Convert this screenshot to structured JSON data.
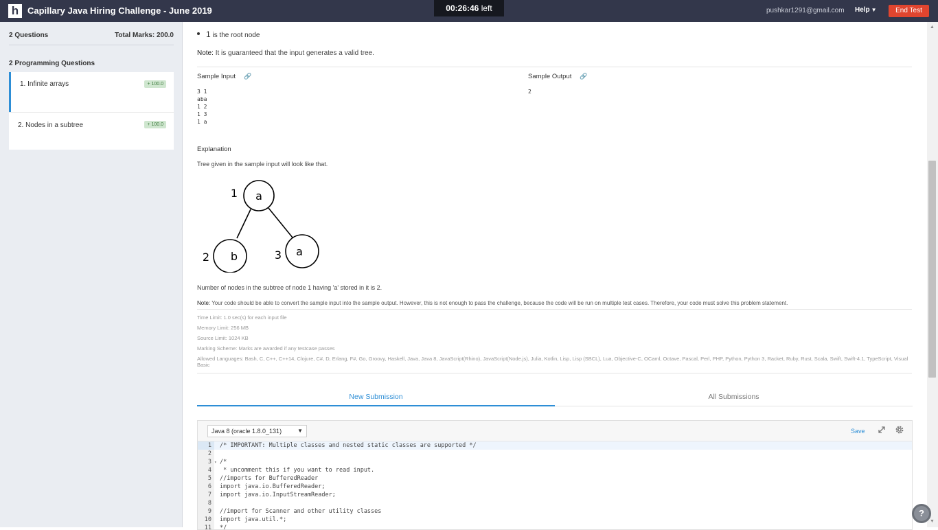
{
  "header": {
    "logo_letter": "h",
    "title": "Capillary Java Hiring Challenge - June 2019",
    "timer_value": "00:26:46",
    "timer_suffix": "left",
    "user_email": "pushkar1291@gmail.com",
    "help_label": "Help",
    "end_test_label": "End Test"
  },
  "sidebar": {
    "questions_count": "2 Questions",
    "total_marks": "Total Marks: 200.0",
    "section_title": "2 Programming Questions",
    "questions": [
      {
        "label": "1. Infinite arrays",
        "marks": "+ 100.0"
      },
      {
        "label": "2. Nodes in a subtree",
        "marks": "+ 100.0"
      }
    ]
  },
  "problem": {
    "bullet_num": "1",
    "bullet_text": "is the root node",
    "note_label": "Note:",
    "note_text": "It is guaranteed that the input generates a valid tree.",
    "sample_input_title": "Sample Input",
    "sample_output_title": "Sample Output",
    "sample_input": "3 1\naba\n1 2\n1 3\n1 a",
    "sample_output": "2",
    "explanation_title": "Explanation",
    "explanation_text": "Tree given in the sample input will look like that.",
    "tree": {
      "nodes": [
        {
          "id": "1",
          "value": "a"
        },
        {
          "id": "2",
          "value": "b"
        },
        {
          "id": "3",
          "value": "a"
        }
      ]
    },
    "count_text": "Number of nodes in the subtree of node 1 having 'a' stored in it is 2.",
    "note2_label": "Note:",
    "note2_text": "Your code should be able to convert the sample input into the sample output. However, this is not enough to pass the challenge, because the code will be run on multiple test cases. Therefore, your code must solve this problem statement.",
    "limits": {
      "time": "Time Limit: 1.0 sec(s) for each input file",
      "memory": "Memory Limit: 256 MB",
      "source": "Source Limit: 1024 KB",
      "marking": "Marking Scheme: Marks are awarded if any testcase passes",
      "languages": "Allowed Languages: Bash, C, C++, C++14, Clojure, C#, D, Erlang, F#, Go, Groovy, Haskell, Java, Java 8, JavaScript(Rhino), JavaScript(Node.js), Julia, Kotlin, Lisp, Lisp (SBCL), Lua, Objective-C, OCaml, Octave, Pascal, Perl, PHP, Python, Python 3, Racket, Ruby, Rust, Scala, Swift, Swift-4.1, TypeScript, Visual Basic"
    }
  },
  "tabs": {
    "new_submission": "New Submission",
    "all_submissions": "All Submissions"
  },
  "editor": {
    "language": "Java 8 (oracle 1.8.0_131)",
    "save_label": "Save",
    "lines": [
      {
        "n": "1",
        "text": "/* IMPORTANT: Multiple classes and nested static classes are supported */"
      },
      {
        "n": "2",
        "text": ""
      },
      {
        "n": "3",
        "text": "/*"
      },
      {
        "n": "4",
        "text": " * uncomment this if you want to read input."
      },
      {
        "n": "5",
        "text": "//imports for BufferedReader"
      },
      {
        "n": "6",
        "text": "import java.io.BufferedReader;"
      },
      {
        "n": "7",
        "text": "import java.io.InputStreamReader;"
      },
      {
        "n": "8",
        "text": ""
      },
      {
        "n": "9",
        "text": "//import for Scanner and other utility classes"
      },
      {
        "n": "10",
        "text": "import java.util.*;"
      },
      {
        "n": "11",
        "text": "*/"
      }
    ]
  },
  "help_fab": "?"
}
